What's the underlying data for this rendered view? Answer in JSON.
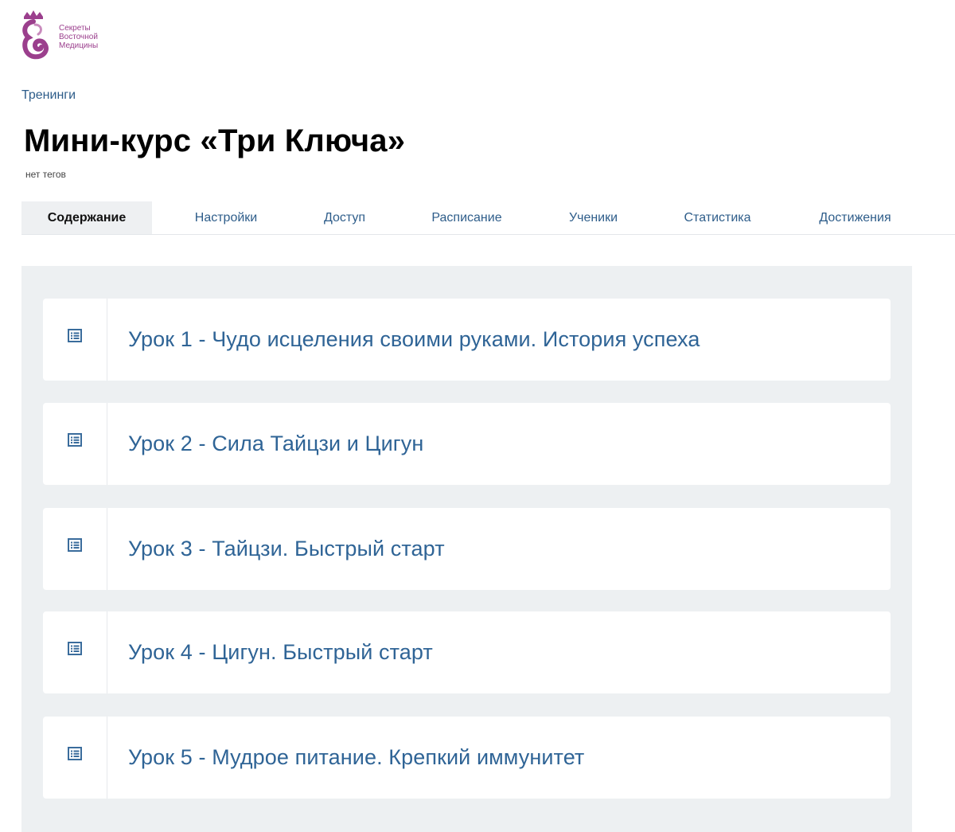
{
  "logo": {
    "line1": "Секреты",
    "line2": "Восточной",
    "line3": "Медицины",
    "color": "#9b3f8d"
  },
  "breadcrumb": "Тренинги",
  "page_title": "Мини-курс «Три Ключа»",
  "tags": "нет тегов",
  "tabs": [
    {
      "label": "Содержание",
      "active": true
    },
    {
      "label": "Настройки",
      "active": false
    },
    {
      "label": "Доступ",
      "active": false
    },
    {
      "label": "Расписание",
      "active": false
    },
    {
      "label": "Ученики",
      "active": false
    },
    {
      "label": "Статистика",
      "active": false
    },
    {
      "label": "Достижения",
      "active": false
    }
  ],
  "lessons": [
    {
      "title": "Урок 1 - Чудо исцеления своими руками. История успеха",
      "icon": "lesson-icon"
    },
    {
      "title": "Урок 2 - Сила Тайцзи и Цигун",
      "icon": "lesson-icon"
    },
    {
      "title": "Урок 3 - Тайцзи. Быстрый старт",
      "icon": "lesson-icon"
    },
    {
      "title": "Урок 4 - Цигун. Быстрый старт",
      "icon": "lesson-icon"
    },
    {
      "title": "Урок 5 - Мудрое питание. Крепкий иммунитет",
      "icon": "lesson-icon"
    }
  ],
  "colors": {
    "link": "#2e5d8a",
    "lesson_text": "#2f6496",
    "panel_bg": "#edf0f2",
    "icon": "#3a6c9c"
  }
}
